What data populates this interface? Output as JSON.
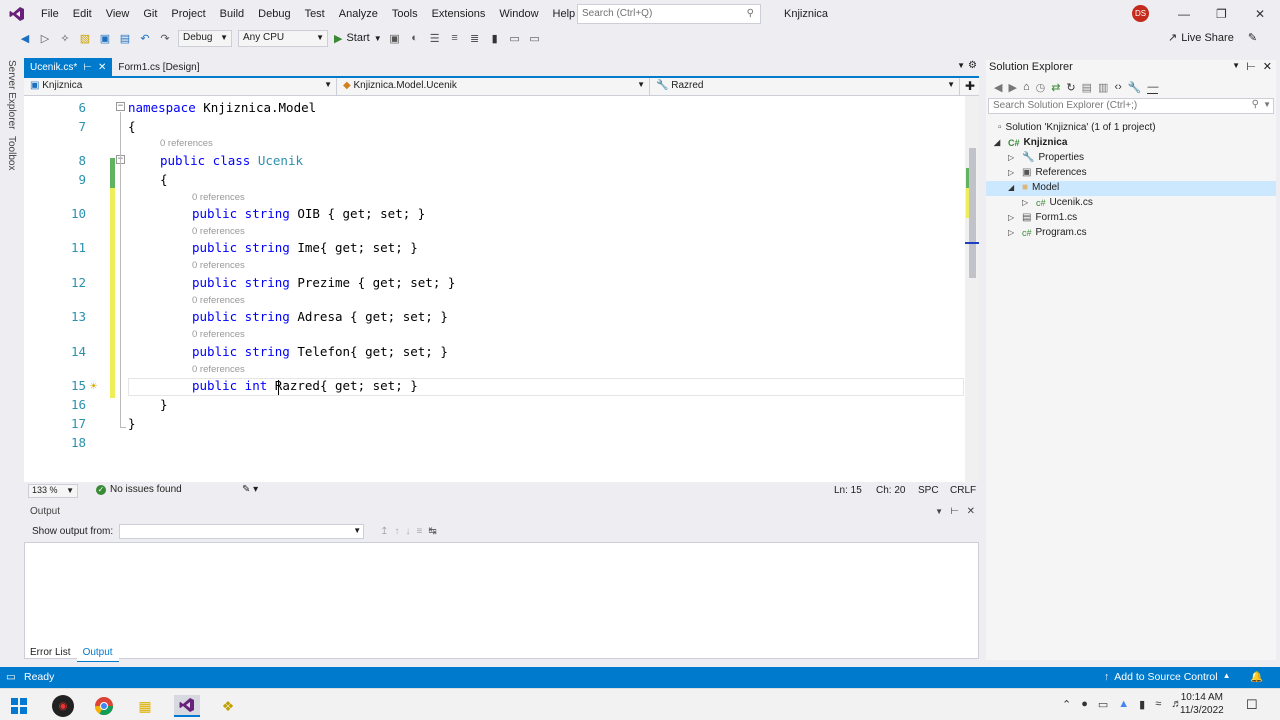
{
  "colors": {
    "accent": "#007acc",
    "vs_purple": "#68217a",
    "keyword": "#0000ff",
    "type": "#2b91af"
  },
  "menubar": {
    "items": [
      "File",
      "Edit",
      "View",
      "Git",
      "Project",
      "Build",
      "Debug",
      "Test",
      "Analyze",
      "Tools",
      "Extensions",
      "Window",
      "Help"
    ],
    "search_placeholder": "Search (Ctrl+Q)",
    "solution_name": "Knjiznica",
    "avatar_initials": "DS"
  },
  "toolbar": {
    "config": "Debug",
    "platform": "Any CPU",
    "start_label": "Start",
    "live_share": "Live Share"
  },
  "left_tabs": [
    "Server Explorer",
    "Toolbox"
  ],
  "editor": {
    "tabs": [
      {
        "label": "Ucenik.cs*",
        "active": true
      },
      {
        "label": "Form1.cs [Design]",
        "active": false
      }
    ],
    "nav": {
      "project": "Knjiznica",
      "class": "Knjiznica.Model.Ucenik",
      "member": "Razred"
    },
    "lines": [
      {
        "n": "6",
        "ref": ""
      },
      {
        "n": "7",
        "ref": ""
      },
      {
        "n": "8",
        "ref": "0 references"
      },
      {
        "n": "9",
        "ref": ""
      },
      {
        "n": "10",
        "ref": "0 references"
      },
      {
        "n": "11",
        "ref": "0 references"
      },
      {
        "n": "12",
        "ref": "0 references"
      },
      {
        "n": "13",
        "ref": "0 references"
      },
      {
        "n": "14",
        "ref": "0 references"
      },
      {
        "n": "15",
        "ref": "0 references"
      },
      {
        "n": "16",
        "ref": ""
      },
      {
        "n": "17",
        "ref": ""
      },
      {
        "n": "18",
        "ref": ""
      }
    ],
    "code": {
      "l6": [
        "namespace",
        " Knjiznica.Model"
      ],
      "l7": "{",
      "l8": [
        "public class ",
        "Ucenik"
      ],
      "l9": "{",
      "l10": [
        "public string ",
        "OIB { get; set; }"
      ],
      "l11": [
        "public string ",
        "Ime{ get; set; }"
      ],
      "l12": [
        "public string ",
        "Prezime { get; set; }"
      ],
      "l13": [
        "public string ",
        "Adresa { get; set; }"
      ],
      "l14": [
        "public string ",
        "Telefon{ get; set; }"
      ],
      "l15": [
        "public int ",
        "Razred{ get; set; }"
      ],
      "l16": "}",
      "l17": "}"
    },
    "zoom": "133 %",
    "issues": "No issues found",
    "position": {
      "line": "Ln: 15",
      "col": "Ch: 20",
      "indent": "SPC",
      "eol": "CRLF"
    }
  },
  "output": {
    "title": "Output",
    "show_from_label": "Show output from:",
    "source": ""
  },
  "bottom_tabs": [
    "Error List",
    "Output"
  ],
  "solution_explorer": {
    "title": "Solution Explorer",
    "search_placeholder": "Search Solution Explorer (Ctrl+;)",
    "tree": [
      {
        "label": "Solution 'Knjiznica' (1 of 1 project)",
        "depth": 0,
        "icon": "solution-icon"
      },
      {
        "label": "Knjiznica",
        "depth": 1,
        "icon": "csharp-project-icon",
        "bold": true
      },
      {
        "label": "Properties",
        "depth": 2,
        "icon": "wrench-icon"
      },
      {
        "label": "References",
        "depth": 2,
        "icon": "references-icon"
      },
      {
        "label": "Model",
        "depth": 2,
        "icon": "folder-icon",
        "selected": true
      },
      {
        "label": "Ucenik.cs",
        "depth": 3,
        "icon": "csharp-file-icon"
      },
      {
        "label": "Form1.cs",
        "depth": 2,
        "icon": "form-icon"
      },
      {
        "label": "Program.cs",
        "depth": 2,
        "icon": "csharp-file-icon"
      }
    ]
  },
  "statusbar": {
    "ready": "Ready",
    "source_control": "Add to Source Control"
  },
  "taskbar": {
    "time": "10:14 AM",
    "date": "11/3/2022"
  }
}
